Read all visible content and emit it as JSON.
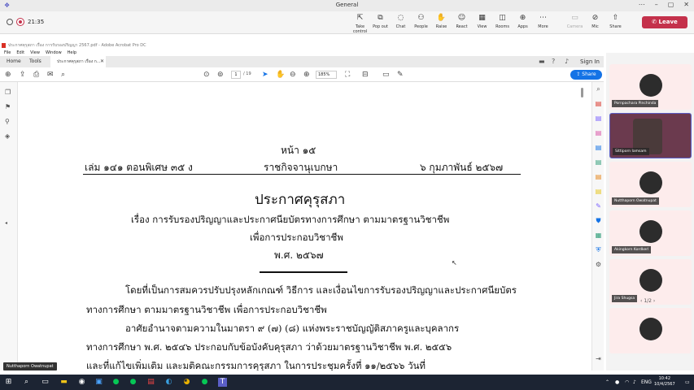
{
  "teams": {
    "title": "General",
    "timer": "21:35",
    "tools": [
      {
        "icon": "share-tray-icon",
        "label": "Take control"
      },
      {
        "icon": "pop-out-icon",
        "label": "Pop out"
      },
      {
        "icon": "chat-icon",
        "label": "Chat"
      },
      {
        "icon": "people-icon",
        "label": "People"
      },
      {
        "icon": "raise-hand-icon",
        "label": "Raise"
      },
      {
        "icon": "react-icon",
        "label": "React"
      },
      {
        "icon": "view-icon",
        "label": "View"
      },
      {
        "icon": "rooms-icon",
        "label": "Rooms"
      },
      {
        "icon": "apps-icon",
        "label": "Apps"
      },
      {
        "icon": "more-icon",
        "label": "More"
      },
      {
        "icon": "camera-icon",
        "label": "Camera"
      },
      {
        "icon": "mic-icon",
        "label": "Mic"
      },
      {
        "icon": "share-icon",
        "label": "Share"
      }
    ],
    "leave_label": "Leave",
    "presenter_caption": "Nutthaporn Owatnupat",
    "participants": [
      {
        "name": "Pornpachara Pinchinda",
        "video": false
      },
      {
        "name": "Sittiporn Iamsam",
        "video": true
      },
      {
        "name": "Nutthaporn Owatnupat",
        "video": false
      },
      {
        "name": "Akingkorn Kordkerl",
        "video": false
      },
      {
        "name": "Jira Shugsa",
        "video": false
      },
      {
        "name": "",
        "video": false
      }
    ],
    "pager": "1/2"
  },
  "acrobat": {
    "window_title": "ประกาศคุรุสภา เรื่อง การรับรองปริญญา 2567.pdf - Adobe Acrobat Pro DC",
    "menu": [
      "File",
      "Edit",
      "View",
      "Window",
      "Help"
    ],
    "tabs": {
      "home": "Home",
      "tools": "Tools",
      "doc": "ประกาศคุรุสภา เรื่อง ก..."
    },
    "sign_in": "Sign In",
    "page_current": "1",
    "page_total": "/ 19",
    "zoom": "185%",
    "share_label": "Share"
  },
  "document": {
    "page_no": "หน้า ๑๕",
    "header_left": "เล่ม ๑๔๑ ตอนพิเศษ ๓๕ ง",
    "header_center": "ราชกิจจานุเบกษา",
    "header_right": "๖ กุมภาพันธ์ ๒๕๖๗",
    "title": "ประกาศคุรุสภา",
    "subject1": "เรื่อง การรับรองปริญญาและประกาศนียบัตรทางการศึกษา ตามมาตรฐานวิชาชีพ",
    "subject2": "เพื่อการประกอบวิชาชีพ",
    "year": "พ.ศ. ๒๕๖๗",
    "p1a": "โดยที่เป็นการสมควรปรับปรุงหลักเกณฑ์ วิธีการ และเงื่อนไขการรับรองปริญญาและประกาศนียบัตร",
    "p1b": "ทางการศึกษา ตามมาตรฐานวิชาชีพ เพื่อการประกอบวิชาชีพ",
    "p2a": "อาศัยอำนาจตามความในมาตรา ๙ (๗) (๘) แห่งพระราชบัญญัติสภาครูและบุคลากร",
    "p2b": "ทางการศึกษา พ.ศ. ๒๕๔๖ ประกอบกับข้อบังคับคุรุสภา ว่าด้วยมาตรฐานวิชาชีพ พ.ศ. ๒๕๕๖",
    "p2c": "และที่แก้ไขเพิ่มเติม และมติคณะกรรมการคุรุสภา ในการประชุมครั้งที่ ๑๑/๒๕๖๖ วันที่"
  },
  "taskbar": {
    "time": "10:42",
    "date": "10/4/2567",
    "lang": "ENG"
  }
}
